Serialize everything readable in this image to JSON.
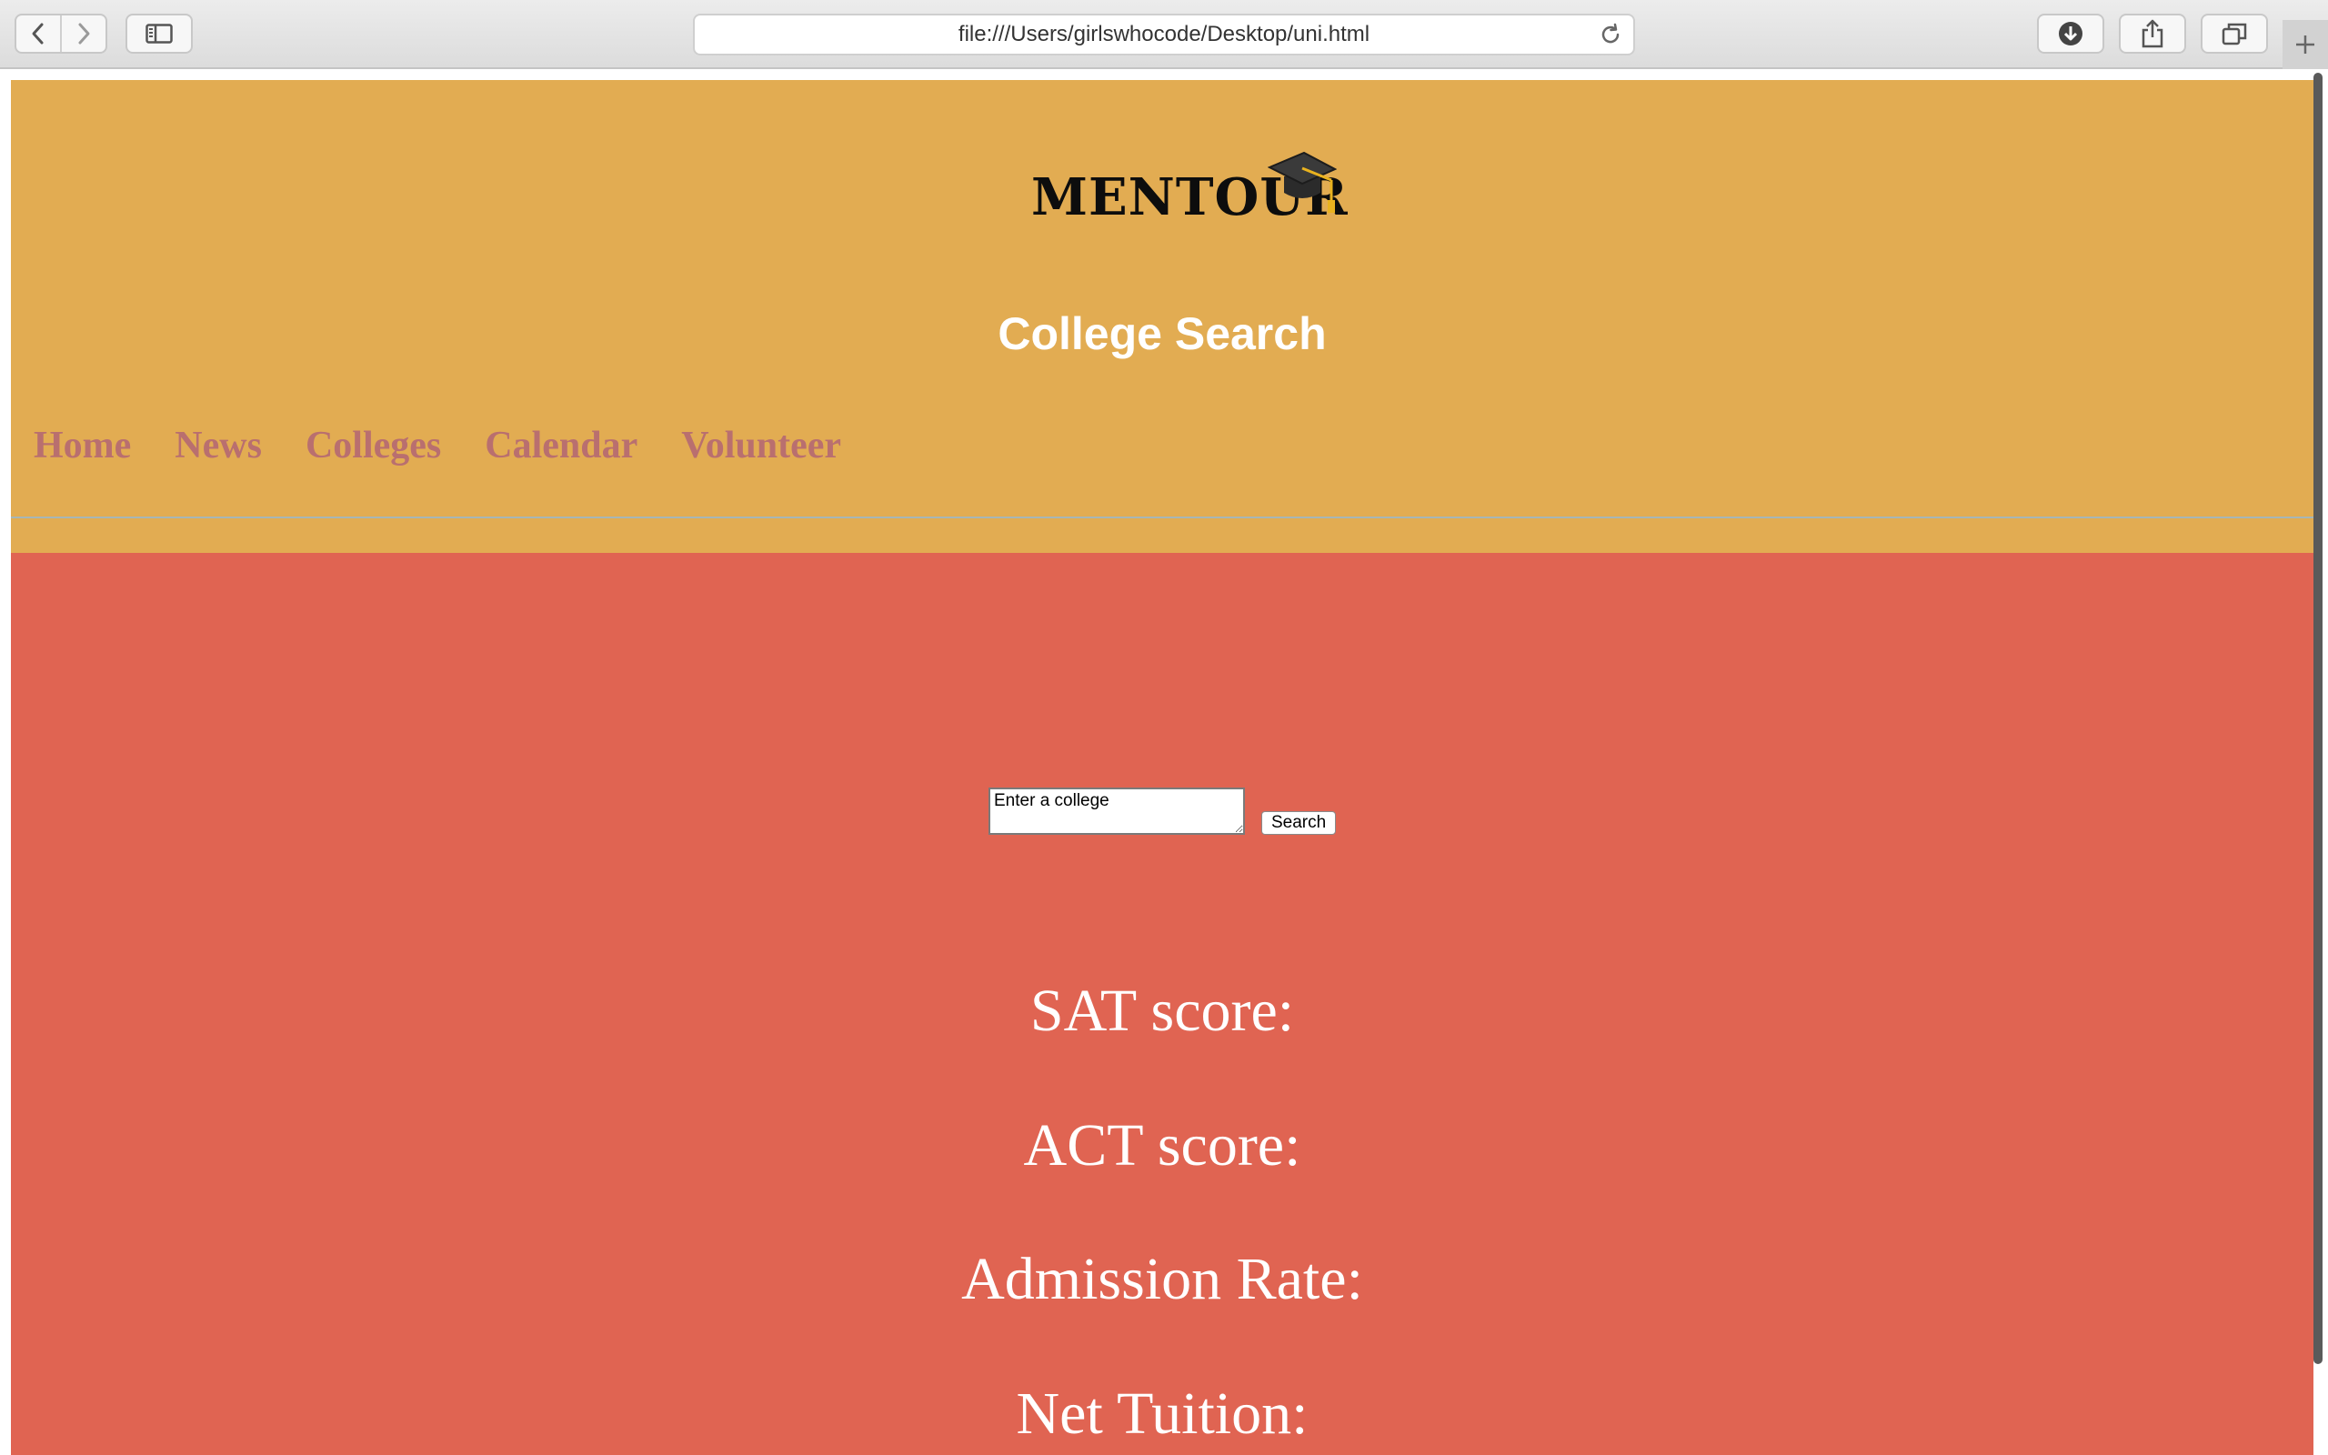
{
  "browser": {
    "url": "file:///Users/girlswhocode/Desktop/uni.html",
    "icons": {
      "back": "chevron-left-icon",
      "forward": "chevron-right-icon",
      "sidebar": "sidebar-icon",
      "reload": "reload-icon",
      "downloads": "download-icon",
      "share": "share-icon",
      "tabs": "tabs-icon",
      "new_tab": "plus-icon"
    }
  },
  "header": {
    "logo_text": "MENTOUR",
    "title": "College Search",
    "background": "#e2ac52"
  },
  "nav": {
    "items": [
      {
        "label": "Home"
      },
      {
        "label": "News"
      },
      {
        "label": "Colleges"
      },
      {
        "label": "Calendar"
      },
      {
        "label": "Volunteer"
      }
    ],
    "color": "#b96f6f"
  },
  "search": {
    "placeholder": "Enter a college",
    "button_label": "Search"
  },
  "results": {
    "sat_label": "SAT score:",
    "act_label": "ACT score:",
    "admission_label": "Admission Rate:",
    "tuition_label": "Net Tuition:"
  },
  "content_background": "#e06452"
}
